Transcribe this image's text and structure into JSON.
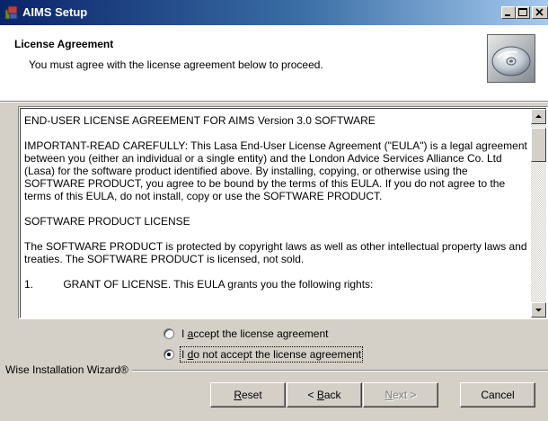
{
  "window": {
    "title": "AIMS Setup",
    "icon": "setup-icon",
    "controls": [
      "minimize-icon",
      "maximize-icon",
      "close-icon"
    ]
  },
  "header": {
    "title": "License Agreement",
    "subtitle": "You must agree with the license agreement below to proceed.",
    "image": "cd-disc-icon"
  },
  "license": {
    "paragraphs": [
      "END-USER LICENSE AGREEMENT FOR AIMS Version 3.0 SOFTWARE",
      "IMPORTANT-READ CAREFULLY: This Lasa End-User License Agreement (\"EULA\") is a legal agreement between you (either an individual or a single entity) and the London Advice Services Alliance Co. Ltd (Lasa) for the software product identified above. By installing, copying, or otherwise using the SOFTWARE PRODUCT, you agree to be bound by the terms of this EULA. If you do not agree to the terms of this EULA, do not install, copy or use the SOFTWARE PRODUCT.",
      "SOFTWARE PRODUCT LICENSE",
      "The SOFTWARE PRODUCT is protected by copyright laws as well as other intellectual property laws and treaties. The SOFTWARE PRODUCT is licensed, not sold.",
      "1.          GRANT OF LICENSE. This EULA grants you the following rights:"
    ]
  },
  "options": {
    "accept": {
      "pre": "I ",
      "key": "a",
      "post": "ccept the license agreement",
      "checked": false
    },
    "decline": {
      "pre": "I ",
      "key": "d",
      "post": "o not accept the license agreement",
      "checked": true
    }
  },
  "footer": {
    "brand": "Wise Installation Wizard®",
    "buttons": {
      "reset": {
        "key": "R",
        "rest": "eset",
        "enabled": true
      },
      "back": {
        "pre": "< ",
        "key": "B",
        "rest": "ack",
        "enabled": true
      },
      "next": {
        "key": "N",
        "rest": "ext >",
        "enabled": false
      },
      "cancel": {
        "label": "Cancel",
        "enabled": true
      }
    }
  },
  "colors": {
    "titlebar_start": "#0a246a",
    "titlebar_end": "#a6caf0",
    "face": "#d4d0c8"
  }
}
